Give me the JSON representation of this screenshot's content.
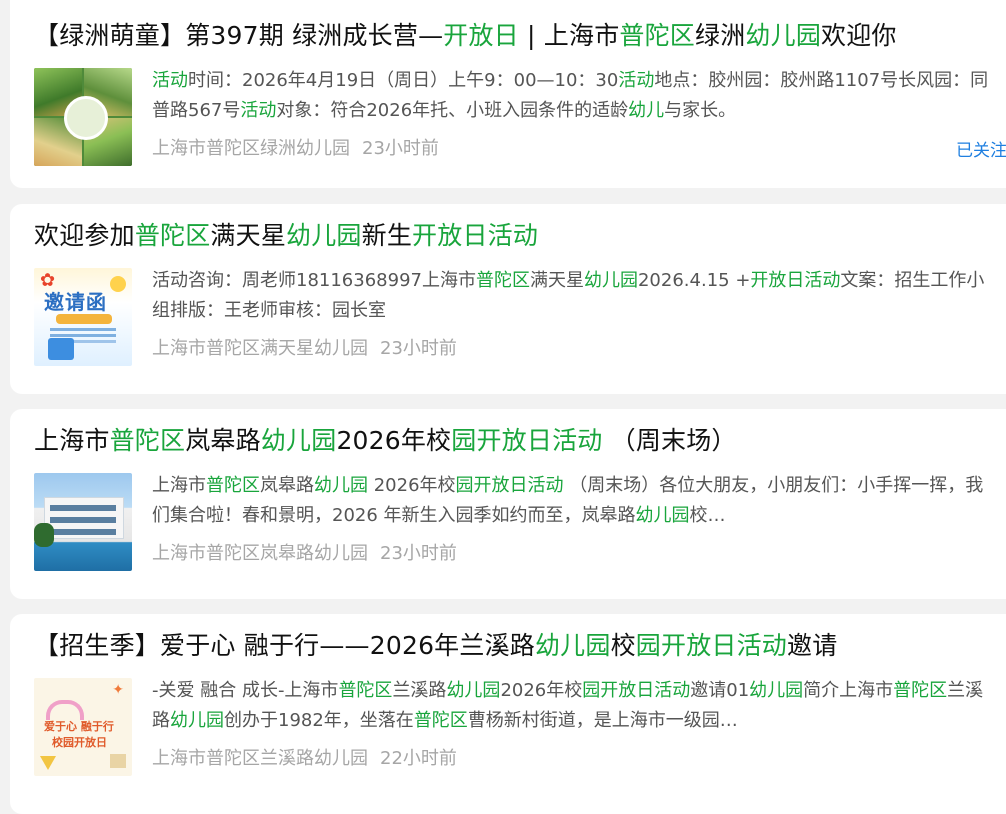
{
  "results": [
    {
      "title_segments": [
        {
          "text": "【绿洲萌童】第397期 绿洲成长营—",
          "hl": false
        },
        {
          "text": "开放日",
          "hl": true
        },
        {
          "text": " | 上海市",
          "hl": false
        },
        {
          "text": "普陀区",
          "hl": true
        },
        {
          "text": "绿洲",
          "hl": false
        },
        {
          "text": "幼儿园",
          "hl": true
        },
        {
          "text": "欢迎你",
          "hl": false
        }
      ],
      "desc_segments": [
        {
          "text": "活动",
          "hl": true
        },
        {
          "text": "时间：2026年4月19日（周日）上午9：00—10：30",
          "hl": false
        },
        {
          "text": "活动",
          "hl": true
        },
        {
          "text": "地点：胶州园：胶州路1107号长风园：同普路567号",
          "hl": false
        },
        {
          "text": "活动",
          "hl": true
        },
        {
          "text": "对象：符合2026年托、小班入园条件的适龄",
          "hl": false
        },
        {
          "text": "幼儿",
          "hl": true
        },
        {
          "text": "与家长。",
          "hl": false
        }
      ],
      "source": "上海市普陀区绿洲幼儿园",
      "time": "23小时前",
      "follow": "已关注"
    },
    {
      "title_segments": [
        {
          "text": "欢迎参加",
          "hl": false
        },
        {
          "text": "普陀区",
          "hl": true
        },
        {
          "text": "满天星",
          "hl": false
        },
        {
          "text": "幼儿园",
          "hl": true
        },
        {
          "text": "新生",
          "hl": false
        },
        {
          "text": "开放日活动",
          "hl": true
        }
      ],
      "desc_segments": [
        {
          "text": "活动咨询：周老师18116368997上海市",
          "hl": false
        },
        {
          "text": "普陀区",
          "hl": true
        },
        {
          "text": "满天星",
          "hl": false
        },
        {
          "text": "幼儿园",
          "hl": true
        },
        {
          "text": "2026.4.15 +",
          "hl": false
        },
        {
          "text": "开放日活动",
          "hl": true
        },
        {
          "text": "文案：招生工作小组排版：王老师审核：园长室",
          "hl": false
        }
      ],
      "source": "上海市普陀区满天星幼儿园",
      "time": "23小时前"
    },
    {
      "title_segments": [
        {
          "text": "上海市",
          "hl": false
        },
        {
          "text": "普陀区",
          "hl": true
        },
        {
          "text": "岚皋路",
          "hl": false
        },
        {
          "text": "幼儿园",
          "hl": true
        },
        {
          "text": "2026年校",
          "hl": false
        },
        {
          "text": "园开放日活动",
          "hl": true
        },
        {
          "text": " （周末场）",
          "hl": false
        }
      ],
      "desc_segments": [
        {
          "text": "上海市",
          "hl": false
        },
        {
          "text": "普陀区",
          "hl": true
        },
        {
          "text": "岚皋路",
          "hl": false
        },
        {
          "text": "幼儿园",
          "hl": true
        },
        {
          "text": " 2026年校",
          "hl": false
        },
        {
          "text": "园开放日活动",
          "hl": true
        },
        {
          "text": " （周末场）各位大朋友，小朋友们：小手挥一挥，我们集合啦！春和景明，2026 年新生入园季如约而至，岚皋路",
          "hl": false
        },
        {
          "text": "幼儿园",
          "hl": true
        },
        {
          "text": "校…",
          "hl": false
        }
      ],
      "source": "上海市普陀区岚皋路幼儿园",
      "time": "23小时前"
    },
    {
      "title_segments": [
        {
          "text": "【招生季】爱于心 融于行——2026年兰溪路",
          "hl": false
        },
        {
          "text": "幼儿园",
          "hl": true
        },
        {
          "text": "校",
          "hl": false
        },
        {
          "text": "园开放日活动",
          "hl": true
        },
        {
          "text": "邀请",
          "hl": false
        }
      ],
      "desc_segments": [
        {
          "text": "-关爱 融合 成长-上海市",
          "hl": false
        },
        {
          "text": "普陀区",
          "hl": true
        },
        {
          "text": "兰溪路",
          "hl": false
        },
        {
          "text": "幼儿园",
          "hl": true
        },
        {
          "text": "2026年校",
          "hl": false
        },
        {
          "text": "园开放日活动",
          "hl": true
        },
        {
          "text": "邀请01",
          "hl": false
        },
        {
          "text": "幼儿园",
          "hl": true
        },
        {
          "text": "简介上海市",
          "hl": false
        },
        {
          "text": "普陀区",
          "hl": true
        },
        {
          "text": "兰溪路",
          "hl": false
        },
        {
          "text": "幼儿园",
          "hl": true
        },
        {
          "text": "创办于1982年，坐落在",
          "hl": false
        },
        {
          "text": "普陀区",
          "hl": true
        },
        {
          "text": "曹杨新村街道，是上海市一级园…",
          "hl": false
        }
      ],
      "source": "上海市普陀区兰溪路幼儿园",
      "time": "22小时前"
    }
  ],
  "thumbnails": {
    "card2_text": "邀请函",
    "card4_line1": "爱于心 融于行",
    "card4_line2": "校园开放日"
  },
  "colors": {
    "highlight": "#19a53c",
    "title_text": "#111111",
    "desc_text": "#555555",
    "meta_text": "#a6a6a6",
    "follow_link": "#1f7fe0",
    "page_bg": "#f2f2f2"
  }
}
